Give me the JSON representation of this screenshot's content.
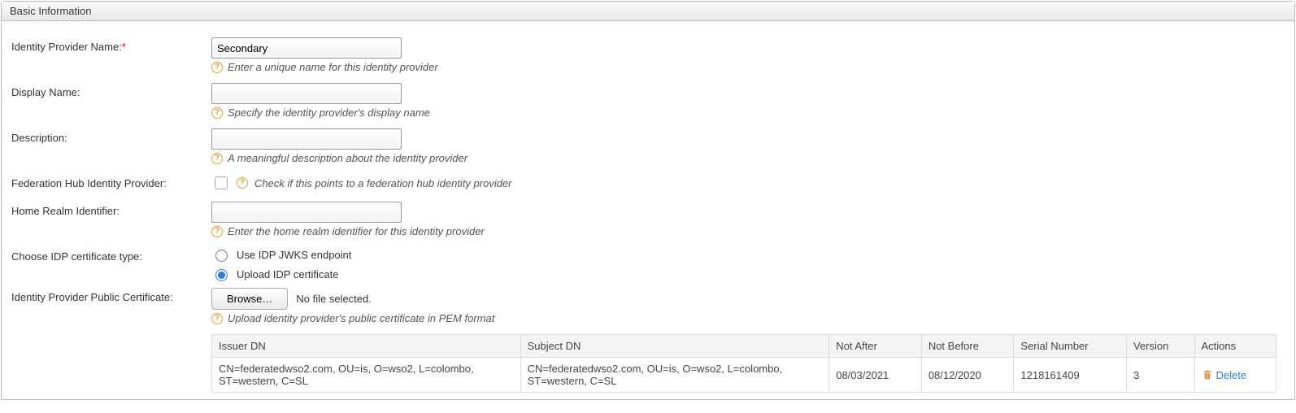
{
  "panel": {
    "title": "Basic Information"
  },
  "fields": {
    "idpName": {
      "label": "Identity Provider Name:",
      "value": "Secondary",
      "hint": "Enter a unique name for this identity provider"
    },
    "displayName": {
      "label": "Display Name:",
      "value": "",
      "hint": "Specify the identity provider's display name"
    },
    "description": {
      "label": "Description:",
      "value": "",
      "hint": "A meaningful description about the identity provider"
    },
    "fedHub": {
      "label": "Federation Hub Identity Provider:",
      "hint": "Check if this points to a federation hub identity provider"
    },
    "homeRealm": {
      "label": "Home Realm Identifier:",
      "value": "",
      "hint": "Enter the home realm identifier for this identity provider"
    },
    "certType": {
      "label": "Choose IDP certificate type:",
      "optionJwks": "Use IDP JWKS endpoint",
      "optionUpload": "Upload IDP certificate"
    },
    "publicCert": {
      "label": "Identity Provider Public Certificate:",
      "browse": "Browse…",
      "noFile": "No file selected.",
      "hint": "Upload identity provider's public certificate in PEM format"
    }
  },
  "certTable": {
    "headers": {
      "issuer": "Issuer DN",
      "subject": "Subject DN",
      "notAfter": "Not After",
      "notBefore": "Not Before",
      "serial": "Serial Number",
      "version": "Version",
      "actions": "Actions"
    },
    "row0": {
      "issuer": "CN=federatedwso2.com, OU=is, O=wso2, L=colombo, ST=western, C=SL",
      "subject": "CN=federatedwso2.com, OU=is, O=wso2, L=colombo, ST=western, C=SL",
      "notAfter": "08/03/2021",
      "notBefore": "08/12/2020",
      "serial": "1218161409",
      "version": "3",
      "deleteLabel": "Delete"
    }
  }
}
